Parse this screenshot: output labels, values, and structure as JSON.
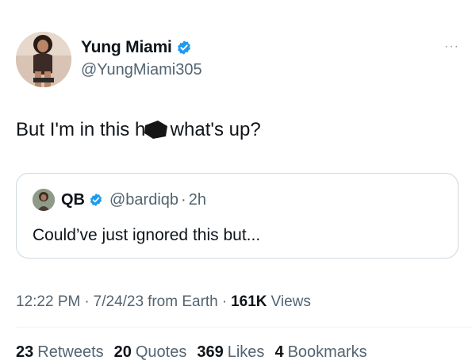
{
  "tweet": {
    "author": {
      "display_name": "Yung Miami",
      "handle": "@YungMiami305",
      "verified": true
    },
    "text_before": "But I'm in this ho",
    "text_after": "what's up?",
    "more_menu": "···",
    "quote": {
      "display_name": "QB",
      "handle": "@bardiqb",
      "dot": "·",
      "time": "2h",
      "text": "Could’ve just ignored this but..."
    },
    "meta": {
      "time": "12:22 PM",
      "sep": "·",
      "date": "7/24/23",
      "source": "from Earth",
      "views_count": "161K",
      "views_label": "Views"
    },
    "stats": [
      {
        "num": "23",
        "label": "Retweets"
      },
      {
        "num": "20",
        "label": "Quotes"
      },
      {
        "num": "369",
        "label": "Likes"
      },
      {
        "num": "4",
        "label": "Bookmarks"
      }
    ]
  },
  "colors": {
    "verified_blue": "#1d9bf0",
    "secondary_text": "#536471",
    "border": "#cfd9de"
  }
}
